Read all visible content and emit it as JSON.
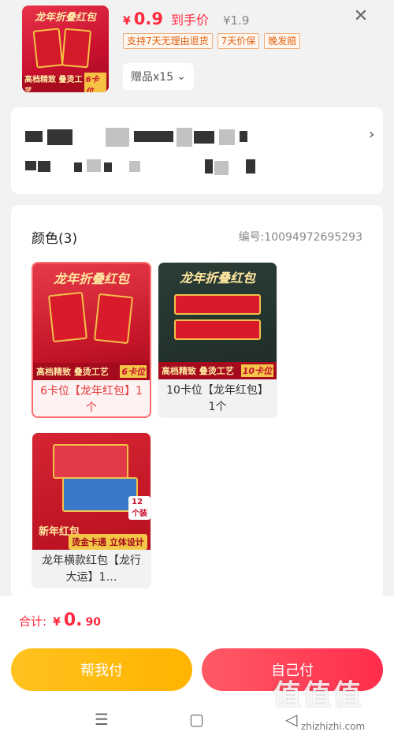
{
  "product": {
    "thumb_title": "龙年折叠红包",
    "thumb_banner": "高档精致 叠烫工艺",
    "thumb_slot": "6卡位",
    "price_symbol": "¥",
    "price": "0.9",
    "price_label": "到手价",
    "original_price": "¥1.9",
    "tags": [
      "支持7天无理由退货",
      "7天价保",
      "晚发赔"
    ],
    "gift_label": "赠品x15"
  },
  "spec": {
    "title": "颜色(3)",
    "code": "编号:10094972695293",
    "options": [
      {
        "label": "6卡位【龙年红包】1个",
        "selected": true,
        "img_title": "龙年折叠红包",
        "img_bar": "高档精致 叠烫工艺",
        "img_slot": "6卡位"
      },
      {
        "label": "10卡位【龙年红包】1个",
        "selected": false,
        "img_title": "龙年折叠红包",
        "img_bar": "高档精致 叠烫工艺",
        "img_slot": "10卡位"
      },
      {
        "label": "龙年横款红包【龙行大运】1…",
        "selected": false,
        "img_new": "新年红包",
        "img_pack": "12个装",
        "img_bar": "烫金卡通 立体设计"
      }
    ]
  },
  "footer": {
    "total_label": "合计:",
    "total_symbol": "¥",
    "total_int": "0.",
    "total_dec": "90",
    "help_pay": "帮我付",
    "self_pay": "自己付"
  },
  "watermark": {
    "text": "值值值",
    "url": "zhizhizhi.com"
  },
  "colors": {
    "accent": "#ff2a3f",
    "help_button": "#ffb400",
    "self_button": "#ff2d4b",
    "tag_text": "#e06010"
  }
}
